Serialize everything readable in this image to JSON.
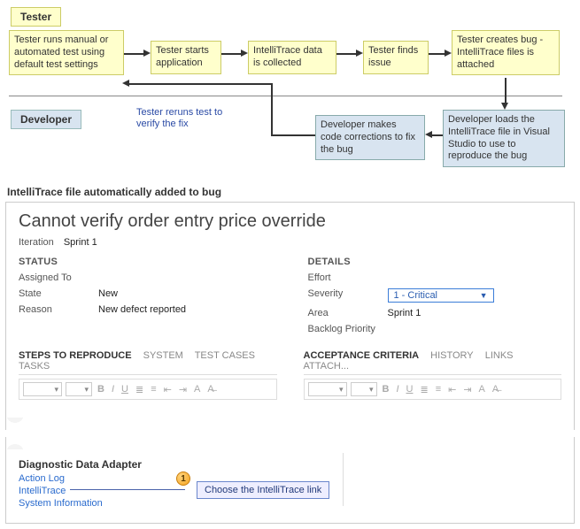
{
  "roles": {
    "tester": "Tester",
    "developer": "Developer"
  },
  "flow": {
    "t1": "Tester runs manual or automated test using default test settings",
    "t2": "Tester starts application",
    "t3": "IntelliTrace data is collected",
    "t4": "Tester finds issue",
    "t5": "Tester creates bug - IntelliTrace files is attached",
    "d1": "Developer loads the IntelliTrace file in Visual Studio to use to reproduce the bug",
    "d2": "Developer makes code corrections to fix the bug",
    "note": "Tester reruns test to verify the fix"
  },
  "caption": "IntelliTrace file automatically added to bug",
  "bug": {
    "title": "Cannot verify order entry price override",
    "iteration_label": "Iteration",
    "iteration_value": "Sprint 1",
    "status": {
      "heading": "STATUS",
      "assigned_to": {
        "label": "Assigned To",
        "value": ""
      },
      "state": {
        "label": "State",
        "value": "New"
      },
      "reason": {
        "label": "Reason",
        "value": "New defect reported"
      }
    },
    "details": {
      "heading": "DETAILS",
      "effort": {
        "label": "Effort",
        "value": ""
      },
      "severity": {
        "label": "Severity",
        "value": "1 - Critical"
      },
      "area": {
        "label": "Area",
        "value": "Sprint 1"
      },
      "backlog": {
        "label": "Backlog Priority",
        "value": ""
      }
    },
    "tabs_left": [
      "STEPS TO REPRODUCE",
      "SYSTEM",
      "TEST CASES",
      "TASKS"
    ],
    "tabs_right": [
      "ACCEPTANCE CRITERIA",
      "HISTORY",
      "LINKS",
      "ATTACH..."
    ]
  },
  "dda": {
    "heading": "Diagnostic Data Adapter",
    "links": [
      "Action Log",
      "IntelliTrace",
      "System Information"
    ]
  },
  "callout": {
    "num": "1",
    "text": "Choose the IntelliTrace link"
  }
}
